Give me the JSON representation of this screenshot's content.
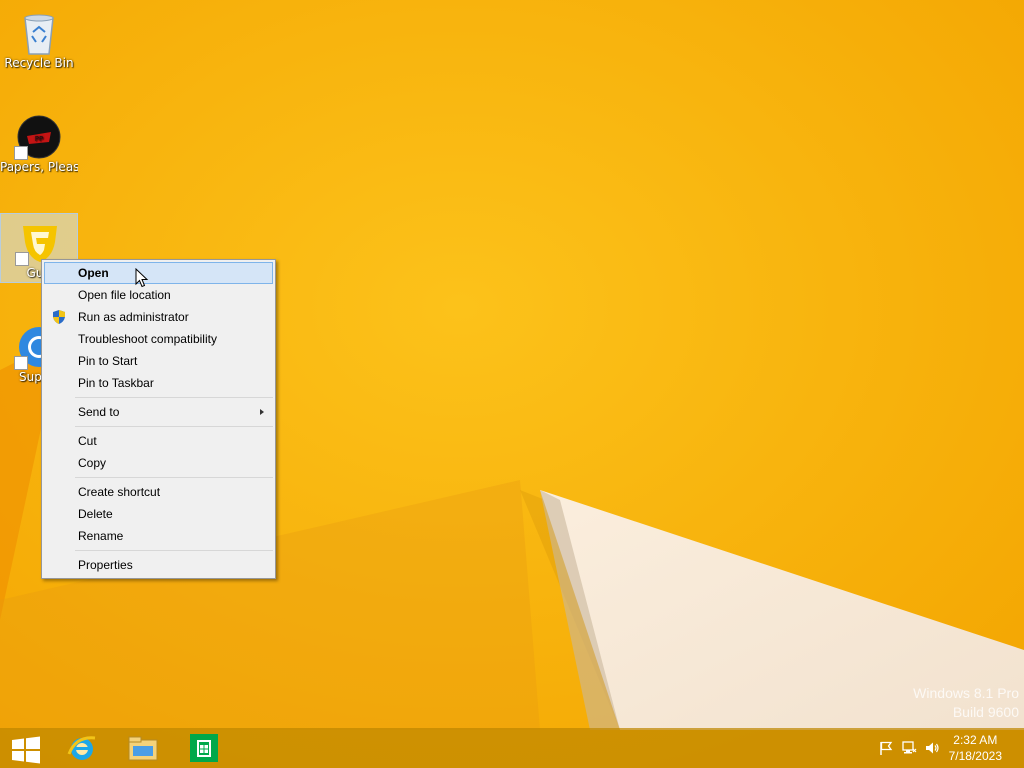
{
  "desktop": {
    "icons": [
      {
        "label": "Recycle Bin",
        "icon": "recycle-bin-icon"
      },
      {
        "label": "Papers, Please",
        "icon": "papers-please-icon"
      },
      {
        "label": "Guili",
        "icon": "guilded-icon"
      },
      {
        "label": "Superr",
        "icon": "chrome-like-icon"
      }
    ]
  },
  "context_menu": {
    "groups": [
      [
        "Open",
        "Open file location",
        "Run as administrator",
        "Troubleshoot compatibility",
        "Pin to Start",
        "Pin to Taskbar"
      ],
      [
        "Send to"
      ],
      [
        "Cut",
        "Copy"
      ],
      [
        "Create shortcut",
        "Delete",
        "Rename"
      ],
      [
        "Properties"
      ]
    ],
    "open": "Open",
    "open_file_location": "Open file location",
    "run_as_admin": "Run as administrator",
    "troubleshoot": "Troubleshoot compatibility",
    "pin_start": "Pin to Start",
    "pin_taskbar": "Pin to Taskbar",
    "send_to": "Send to",
    "cut": "Cut",
    "copy": "Copy",
    "create_shortcut": "Create shortcut",
    "delete": "Delete",
    "rename": "Rename",
    "properties": "Properties"
  },
  "watermark": {
    "line1": "Windows 8.1 Pro",
    "line2": "Build 9600"
  },
  "taskbar": {
    "buttons": [
      "start-icon",
      "internet-explorer-icon",
      "file-explorer-icon",
      "store-icon"
    ],
    "clock_time": "2:32 AM",
    "clock_date": "7/18/2023"
  },
  "colors": {
    "wallpaper": "#f7b400",
    "menu_bg": "#f0f0f0",
    "menu_hover": "#d5e5f7",
    "taskbar": "#be8700"
  }
}
